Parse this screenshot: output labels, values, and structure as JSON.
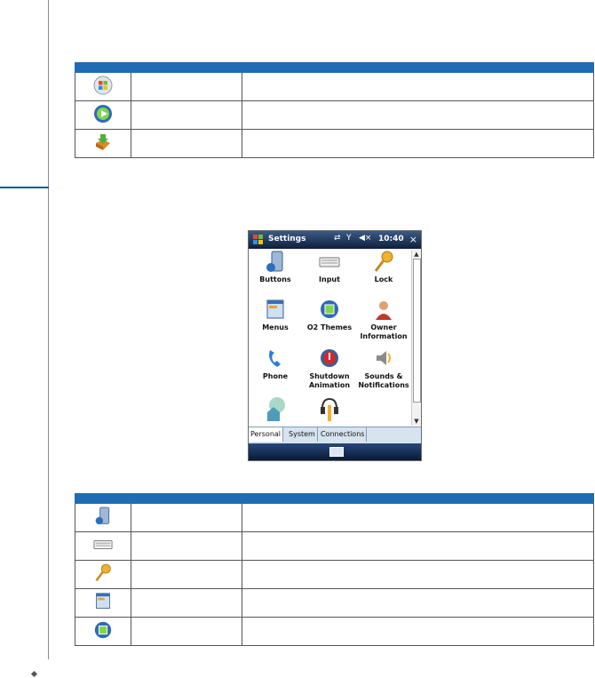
{
  "phone": {
    "title": "Settings",
    "time": "10:40",
    "close": "×",
    "grid": [
      {
        "label": "Buttons",
        "icon": "buttons-icon"
      },
      {
        "label": "Input",
        "icon": "keyboard-icon"
      },
      {
        "label": "Lock",
        "icon": "key-icon"
      },
      {
        "label": "Menus",
        "icon": "menus-icon"
      },
      {
        "label": "O2 Themes",
        "icon": "themes-icon"
      },
      {
        "label": "Owner Information",
        "icon": "owner-icon"
      },
      {
        "label": "Phone",
        "icon": "phone-icon"
      },
      {
        "label": "Shutdown Animation",
        "icon": "shutdown-icon"
      },
      {
        "label": "Sounds & Notifications",
        "icon": "sounds-icon"
      }
    ],
    "tabs": [
      "Personal",
      "System",
      "Connections"
    ]
  },
  "table1_icons": [
    "start-menu-icon",
    "media-player-icon",
    "download-box-icon"
  ],
  "table2_icons": [
    "buttons-icon",
    "keyboard-icon",
    "key-icon",
    "menus-icon",
    "themes-icon"
  ],
  "colors": {
    "header": "#1f6bb4",
    "titlebar": "#1c355e"
  }
}
